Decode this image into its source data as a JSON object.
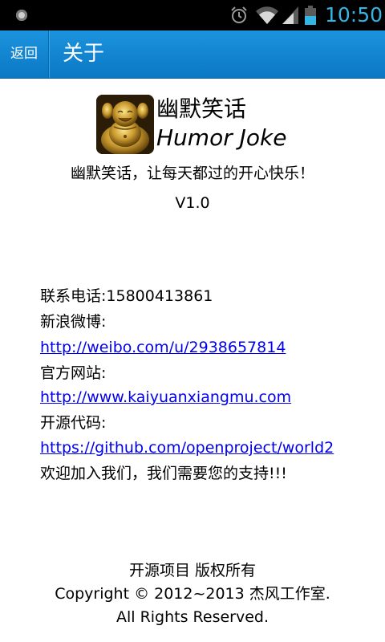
{
  "status_bar": {
    "time": "10:50",
    "accent_color": "#33b5e5",
    "icons": [
      "notification-icon",
      "alarm-icon",
      "wifi-icon",
      "signal-icon",
      "battery-icon"
    ]
  },
  "title_bar": {
    "back_label": "返回",
    "title": "关于",
    "color": "#1283d2"
  },
  "app": {
    "name_cn": "幽默笑话",
    "name_en": "Humor Joke",
    "slogan": "幽默笑话，让每天都过的开心快乐！",
    "version": "V1.0",
    "logo_icon": "laughing-buddha-logo"
  },
  "contact": {
    "phone": "联系电话:15800413861",
    "weibo_label": "新浪微博:",
    "weibo_url": "http://weibo.com/u/2938657814",
    "website_label": "官方网站:",
    "website_url": "http://www.kaiyuanxiangmu.com",
    "source_label": "开源代码:",
    "source_url": "https://github.com/openproject/world2",
    "welcome": "欢迎加入我们，我们需要您的支持!!!",
    "link_color": "#0000ee"
  },
  "footer": {
    "project": "开源项目 版权所有",
    "copyright": "Copyright © 2012~2013 杰风工作室.",
    "rights": "All Rights Reserved."
  }
}
